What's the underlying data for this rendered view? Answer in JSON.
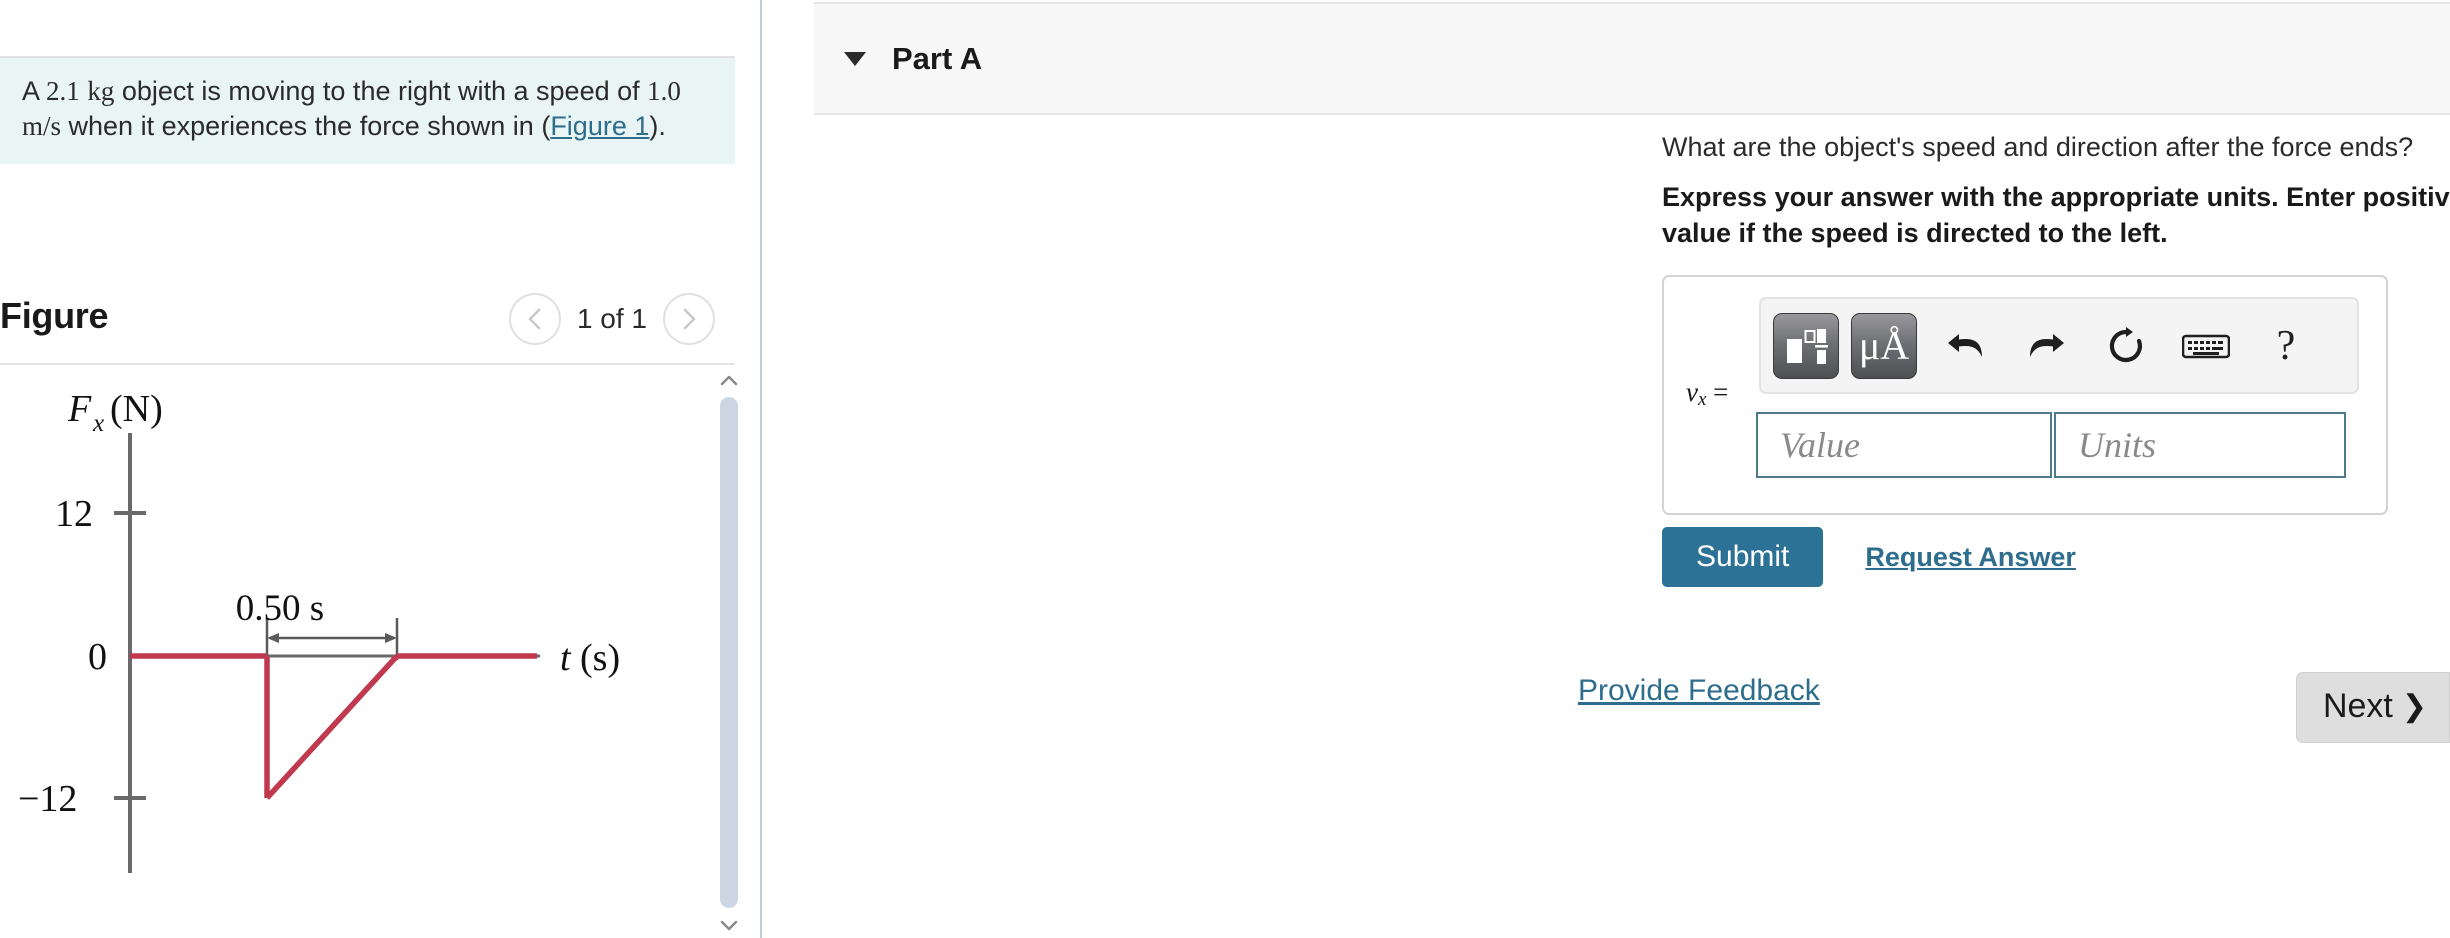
{
  "left": {
    "problem": {
      "mass": "2.1",
      "mass_unit": "kg",
      "speed": "1.0",
      "speed_unit": "m/s",
      "seg1": "A",
      "seg2": "object is moving to the right with a speed of",
      "seg3": "when it experiences the force shown in",
      "open_paren": "(",
      "figure_link": "Figure 1",
      "close_paren": ").",
      "background_color": "#e8f5f4"
    },
    "figure": {
      "title": "Figure",
      "counter": "1 of 1",
      "prev_icon": "chevron-left-icon",
      "next_icon": "chevron-right-icon",
      "scroll_up_icon": "chevron-up-icon",
      "scroll_down_icon": "chevron-down-icon"
    }
  },
  "chart_data": {
    "type": "line",
    "title": "",
    "xlabel": "t (s)",
    "ylabel": "F_x (N)",
    "y_ticks": [
      "12",
      "0",
      "-12"
    ],
    "y_tick_values": [
      12,
      0,
      -12
    ],
    "ylim": [
      -18,
      18
    ],
    "xlim": [
      0,
      1.6
    ],
    "grid": false,
    "legend": false,
    "annotation": "0.50 s",
    "annotation_span_seconds": 0.5,
    "series": [
      {
        "name": "Fx",
        "color": "#c0394f",
        "points": [
          {
            "t": 0.0,
            "Fx": 0
          },
          {
            "t": 0.38,
            "Fx": 0
          },
          {
            "t": 0.38,
            "Fx": -12
          },
          {
            "t": 0.88,
            "Fx": 0
          },
          {
            "t": 1.5,
            "Fx": 0
          }
        ]
      }
    ],
    "axis_color": "#6a6a6a",
    "description": "Force Fx versus time t: zero force, then an instantaneous drop to -12 N at t = 0.38 s, rising linearly back to 0 N over 0.50 s, then zero thereafter."
  },
  "right": {
    "part": {
      "caret_icon": "caret-down-icon",
      "title": "Part A"
    },
    "question": "What are the object's speed and direction after the force ends?",
    "instruction": "Express your answer with the appropriate units. Enter positive value if the speed is directed to the right and negative value if the speed is directed to the left.",
    "toolbar": {
      "template_icon": "math-template-icon",
      "units_icon": "micro-angstrom-units-icon",
      "units_label": "μÅ",
      "undo_icon": "undo-arrow-icon",
      "redo_icon": "redo-arrow-icon",
      "reset_icon": "reset-circular-arrow-icon",
      "keyboard_icon": "keyboard-icon",
      "help_icon": "question-mark-icon",
      "help_label": "?"
    },
    "answer": {
      "variable_label": "v",
      "variable_subscript": "x",
      "equals": "=",
      "value_placeholder": "Value",
      "value": "",
      "units_placeholder": "Units",
      "units": ""
    },
    "submit_label": "Submit",
    "request_answer_label": "Request Answer",
    "provide_feedback_label": "Provide Feedback",
    "next_label": "Next",
    "next_chevron": "❯",
    "accent_color": "#2c7296",
    "link_color": "#2e6d8e"
  }
}
